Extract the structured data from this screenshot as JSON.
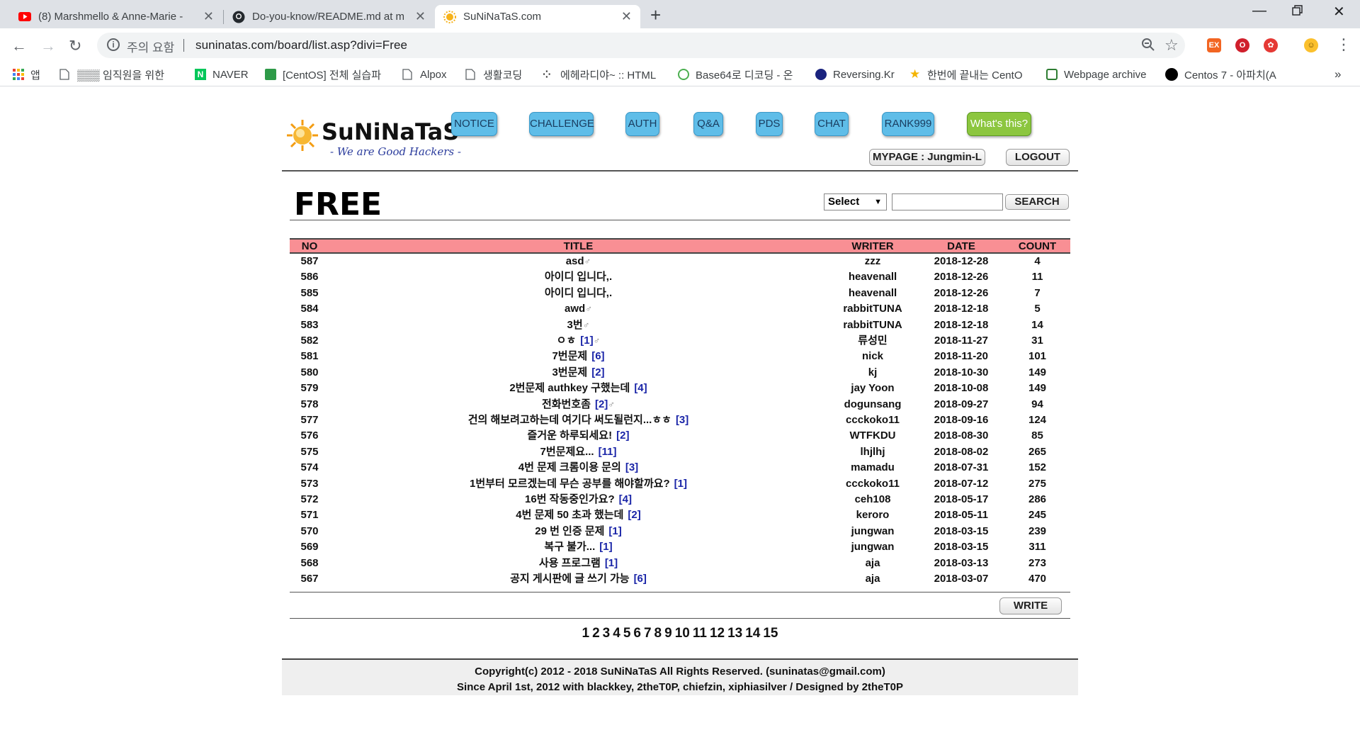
{
  "browser": {
    "tabs": [
      {
        "title": "(8) Marshmello & Anne-Marie -",
        "favicon": "youtube-icon"
      },
      {
        "title": "Do-you-know/README.md at m",
        "favicon": "github-icon"
      },
      {
        "title": "SuNiNaTaS.com",
        "favicon": "sun-icon",
        "active": true
      }
    ],
    "security_label": "주의 요함",
    "url": "suninatas.com/board/list.asp?divi=Free",
    "bookmarks": [
      {
        "label": "앱",
        "icon": "apps-grid-icon"
      },
      {
        "label": "▒▒▒ 임직원을 위한",
        "icon": "page-icon"
      },
      {
        "label": "NAVER",
        "icon": "naver-icon"
      },
      {
        "label": "[CentOS] 전체 실습파",
        "icon": "bookmark-green-icon"
      },
      {
        "label": "Alpox",
        "icon": "page-icon"
      },
      {
        "label": "생활코딩",
        "icon": "page-icon"
      },
      {
        "label": "에헤라디야~ :: HTML",
        "icon": "dots-icon"
      },
      {
        "label": "Base64로 디코딩 - 온",
        "icon": "base64-icon"
      },
      {
        "label": "Reversing.Kr",
        "icon": "globe-icon"
      },
      {
        "label": "한번에 끝내는 CentO",
        "icon": "star-icon"
      },
      {
        "label": "Webpage archive",
        "icon": "archive-icon"
      },
      {
        "label": "Centos 7 - 아파치(A",
        "icon": "circle-icon"
      }
    ]
  },
  "site": {
    "logo_text": "SuNiNaTaS",
    "logo_sub": "- We are Good Hackers -",
    "nav": [
      "NOTICE",
      "CHALLENGE",
      "AUTH",
      "Q&A",
      "PDS",
      "CHAT",
      "RANK999",
      "What's this?"
    ],
    "mypage": "MYPAGE : Jungmin-L",
    "logout": "LOGOUT"
  },
  "board": {
    "title": "FREE",
    "search_select": "Select",
    "search_button": "SEARCH",
    "write_button": "WRITE",
    "headers": {
      "no": "NO",
      "title": "TITLE",
      "writer": "WRITER",
      "date": "DATE",
      "count": "COUNT"
    },
    "rows": [
      {
        "no": "587",
        "title": "asd",
        "comments": "",
        "new": true,
        "writer": "zzz",
        "date": "2018-12-28",
        "count": "4"
      },
      {
        "no": "586",
        "title": "아이디 입니다,.",
        "comments": "",
        "new": false,
        "writer": "heavenall",
        "date": "2018-12-26",
        "count": "11"
      },
      {
        "no": "585",
        "title": "아이디 입니다,.",
        "comments": "",
        "new": false,
        "writer": "heavenall",
        "date": "2018-12-26",
        "count": "7"
      },
      {
        "no": "584",
        "title": "awd",
        "comments": "",
        "new": true,
        "writer": "rabbitTUNA",
        "date": "2018-12-18",
        "count": "5"
      },
      {
        "no": "583",
        "title": "3번",
        "comments": "",
        "new": true,
        "writer": "rabbitTUNA",
        "date": "2018-12-18",
        "count": "14"
      },
      {
        "no": "582",
        "title": "ㅇㅎ",
        "comments": "[1]",
        "new": true,
        "writer": "류성민",
        "date": "2018-11-27",
        "count": "31"
      },
      {
        "no": "581",
        "title": "7번문제",
        "comments": "[6]",
        "new": false,
        "writer": "nick",
        "date": "2018-11-20",
        "count": "101"
      },
      {
        "no": "580",
        "title": "3번문제",
        "comments": "[2]",
        "new": false,
        "writer": "kj",
        "date": "2018-10-30",
        "count": "149"
      },
      {
        "no": "579",
        "title": "2번문제 authkey 구했는데",
        "comments": "[4]",
        "new": false,
        "writer": "jay Yoon",
        "date": "2018-10-08",
        "count": "149"
      },
      {
        "no": "578",
        "title": "전화번호좀",
        "comments": "[2]",
        "new": true,
        "writer": "dogunsang",
        "date": "2018-09-27",
        "count": "94"
      },
      {
        "no": "577",
        "title": "건의 해보려고하는데 여기다 써도될런지...ㅎㅎ",
        "comments": "[3]",
        "new": false,
        "writer": "ccckoko11",
        "date": "2018-09-16",
        "count": "124"
      },
      {
        "no": "576",
        "title": "즐거운 하루되세요!",
        "comments": "[2]",
        "new": false,
        "writer": "WTFKDU",
        "date": "2018-08-30",
        "count": "85"
      },
      {
        "no": "575",
        "title": "7번문제요...",
        "comments": "[11]",
        "new": false,
        "writer": "lhjlhj",
        "date": "2018-08-02",
        "count": "265"
      },
      {
        "no": "574",
        "title": "4번 문제 크롬이용 문의",
        "comments": "[3]",
        "new": false,
        "writer": "mamadu",
        "date": "2018-07-31",
        "count": "152"
      },
      {
        "no": "573",
        "title": "1번부터 모르겠는데 무슨 공부를 해야할까요?",
        "comments": "[1]",
        "new": false,
        "writer": "ccckoko11",
        "date": "2018-07-12",
        "count": "275"
      },
      {
        "no": "572",
        "title": "16번 작동중인가요?",
        "comments": "[4]",
        "new": false,
        "writer": "ceh108",
        "date": "2018-05-17",
        "count": "286"
      },
      {
        "no": "571",
        "title": "4번 문제 50 초과 했는데",
        "comments": "[2]",
        "new": false,
        "writer": "keroro",
        "date": "2018-05-11",
        "count": "245"
      },
      {
        "no": "570",
        "title": "29 번 인증 문제",
        "comments": "[1]",
        "new": false,
        "writer": "jungwan",
        "date": "2018-03-15",
        "count": "239"
      },
      {
        "no": "569",
        "title": "복구 불가...",
        "comments": "[1]",
        "new": false,
        "writer": "jungwan",
        "date": "2018-03-15",
        "count": "311"
      },
      {
        "no": "568",
        "title": "사용 프로그램",
        "comments": "[1]",
        "new": false,
        "writer": "aja",
        "date": "2018-03-13",
        "count": "273"
      },
      {
        "no": "567",
        "title": "공지 게시판에 글 쓰기 가능",
        "comments": "[6]",
        "new": false,
        "writer": "aja",
        "date": "2018-03-07",
        "count": "470"
      }
    ],
    "pages": [
      "1",
      "2",
      "3",
      "4",
      "5",
      "6",
      "7",
      "8",
      "9",
      "10",
      "11",
      "12",
      "13",
      "14",
      "15"
    ]
  },
  "footer": {
    "line1": "Copyright(c) 2012 - 2018 SuNiNaTaS All Rights Reserved. (suninatas@gmail.com)",
    "line2": "Since April 1st, 2012 with blackkey, 2theT0P, chiefzin, xiphiasilver / Designed by 2theT0P"
  },
  "colors": {
    "table_header": "#f98f94",
    "nav_button": "#5fbde8",
    "whats_this_button": "#8cc63f",
    "comment_count": "#1a25a8"
  }
}
